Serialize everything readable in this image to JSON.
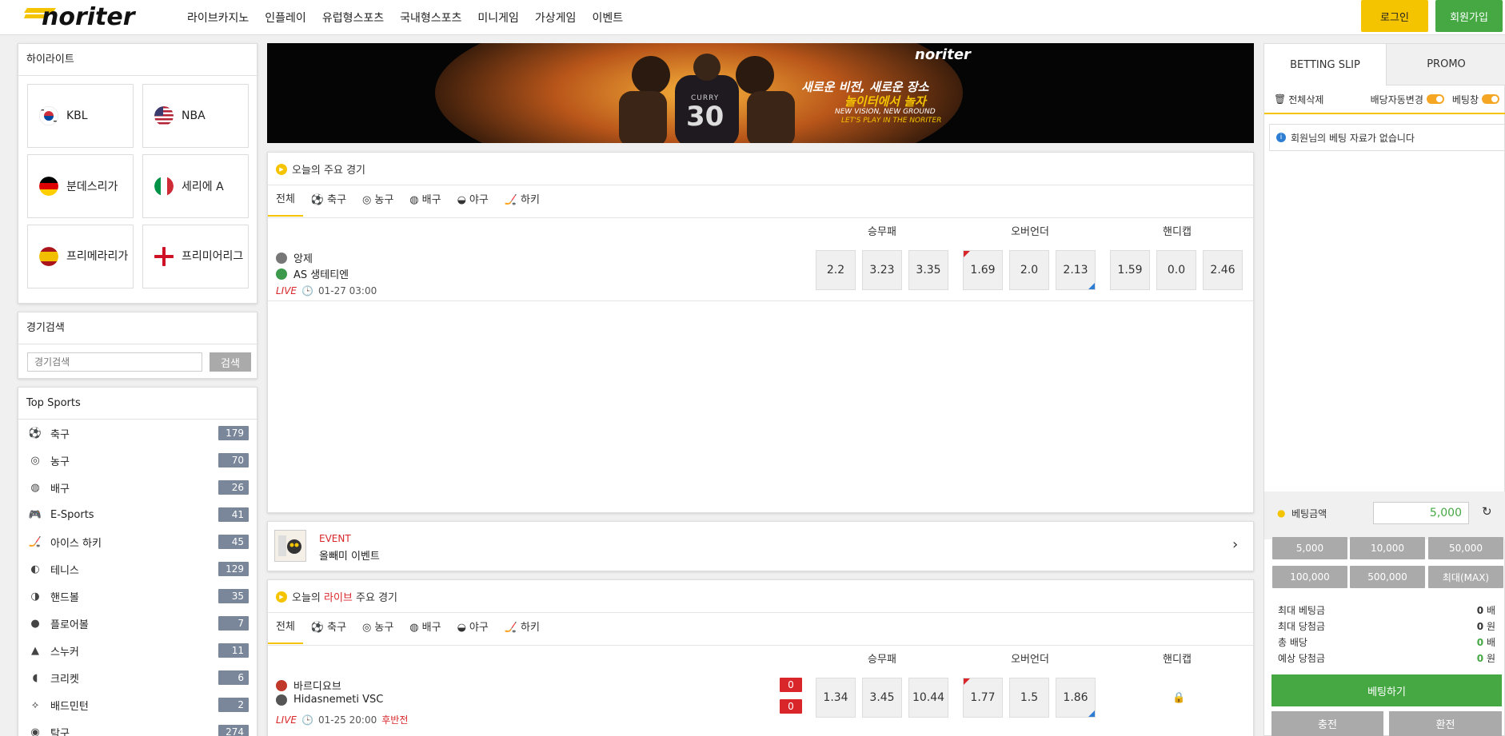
{
  "header": {
    "logo_text": "noriter",
    "nav": [
      "라이브카지노",
      "인플레이",
      "유럽형스포츠",
      "국내형스포츠",
      "미니게임",
      "가상게임",
      "이벤트"
    ],
    "login_label": "로그인",
    "join_label": "회원가입"
  },
  "highlights": {
    "title": "하이라이트",
    "items": [
      {
        "label": "KBL",
        "flag": "kr"
      },
      {
        "label": "NBA",
        "flag": "us"
      },
      {
        "label": "분데스리가",
        "flag": "de"
      },
      {
        "label": "세리에 A",
        "flag": "it"
      },
      {
        "label": "프리메라리가",
        "flag": "es"
      },
      {
        "label": "프리미어리그",
        "flag": "en"
      }
    ]
  },
  "search": {
    "title": "경기검색",
    "placeholder": "경기검색",
    "button": "검색"
  },
  "top_sports": {
    "title": "Top Sports",
    "items": [
      {
        "icon": "soccer-icon",
        "glyph": "⚽",
        "label": "축구",
        "count": "179"
      },
      {
        "icon": "basketball-icon",
        "glyph": "◎",
        "label": "농구",
        "count": "70"
      },
      {
        "icon": "volleyball-icon",
        "glyph": "◍",
        "label": "배구",
        "count": "26"
      },
      {
        "icon": "gamepad-icon",
        "glyph": "🎮",
        "label": "E-Sports",
        "count": "41"
      },
      {
        "icon": "hockey-icon",
        "glyph": "🏒",
        "label": "아이스 하키",
        "count": "45"
      },
      {
        "icon": "tennis-icon",
        "glyph": "◐",
        "label": "테니스",
        "count": "129"
      },
      {
        "icon": "handball-icon",
        "glyph": "◑",
        "label": "핸드볼",
        "count": "35"
      },
      {
        "icon": "floorball-icon",
        "glyph": "●",
        "label": "플로어볼",
        "count": "7"
      },
      {
        "icon": "snooker-icon",
        "glyph": "▲",
        "label": "스누커",
        "count": "11"
      },
      {
        "icon": "cricket-icon",
        "glyph": "◖",
        "label": "크리켓",
        "count": "6"
      },
      {
        "icon": "badminton-icon",
        "glyph": "⟡",
        "label": "배드민턴",
        "count": "2"
      },
      {
        "icon": "table-tennis-icon",
        "glyph": "◉",
        "label": "탁구",
        "count": "274"
      }
    ]
  },
  "banner": {
    "logo": "noriter",
    "line1": "새로운 비전, 새로운 장소",
    "line2": "놀이터에서 놀자",
    "line3": "NEW VISION, NEW GROUND",
    "line4": "LET'S PLAY IN THE NORITER",
    "jersey_name": "CURRY",
    "jersey_number": "30"
  },
  "today": {
    "title": "오늘의 주요 경기",
    "tabs": [
      "전체",
      "축구",
      "농구",
      "배구",
      "야구",
      "하키"
    ],
    "groups": [
      "승무패",
      "오버언더",
      "핸디캡"
    ],
    "match": {
      "home": "앙제",
      "away": "AS 생테티엔",
      "live": "LIVE",
      "time": "01-27 03:00",
      "odds1": [
        "2.2",
        "3.23",
        "3.35"
      ],
      "odds2": [
        "1.69",
        "2.0",
        "2.13"
      ],
      "odds3": [
        "1.59",
        "0.0",
        "2.46"
      ]
    }
  },
  "event": {
    "tag": "EVENT",
    "text": "올빼미 이벤트"
  },
  "live_today": {
    "title_pre": "오늘의 ",
    "title_hl": "라이브",
    "title_post": " 주요 경기",
    "tabs": [
      "전체",
      "축구",
      "농구",
      "배구",
      "야구",
      "하키"
    ],
    "groups": [
      "승무패",
      "오버언더",
      "핸디캡"
    ],
    "match": {
      "home": "바르디요브",
      "away": "Hidasnemeti VSC",
      "live": "LIVE",
      "time": "01-25 20:00",
      "period": "후반전",
      "score_home": "0",
      "score_away": "0",
      "odds1": [
        "1.34",
        "3.45",
        "10.44"
      ],
      "odds2": [
        "1.77",
        "1.5",
        "1.86"
      ]
    }
  },
  "slip": {
    "tab1": "BETTING SLIP",
    "tab2": "PROMO",
    "clear_all": "전체삭제",
    "auto_odds": "배당자동변경",
    "bet_window": "베팅창",
    "empty_msg": "회원님의 베팅 자료가 없습니다",
    "amount_label": "베팅금액",
    "amount_value": "5,000",
    "chips": [
      "5,000",
      "10,000",
      "50,000",
      "100,000",
      "500,000",
      "최대(MAX)"
    ],
    "summary": [
      {
        "label": "최대 베팅금",
        "value": "0",
        "unit": "배",
        "color": "#333"
      },
      {
        "label": "최대 당첨금",
        "value": "0",
        "unit": "원",
        "color": "#333"
      },
      {
        "label": "총 배당",
        "value": "0",
        "unit": "배",
        "color": "#45a843"
      },
      {
        "label": "예상 당첨금",
        "value": "0",
        "unit": "원",
        "color": "#45a843"
      }
    ],
    "bet_button": "베팅하기",
    "deposit": "충전",
    "withdraw": "환전"
  }
}
